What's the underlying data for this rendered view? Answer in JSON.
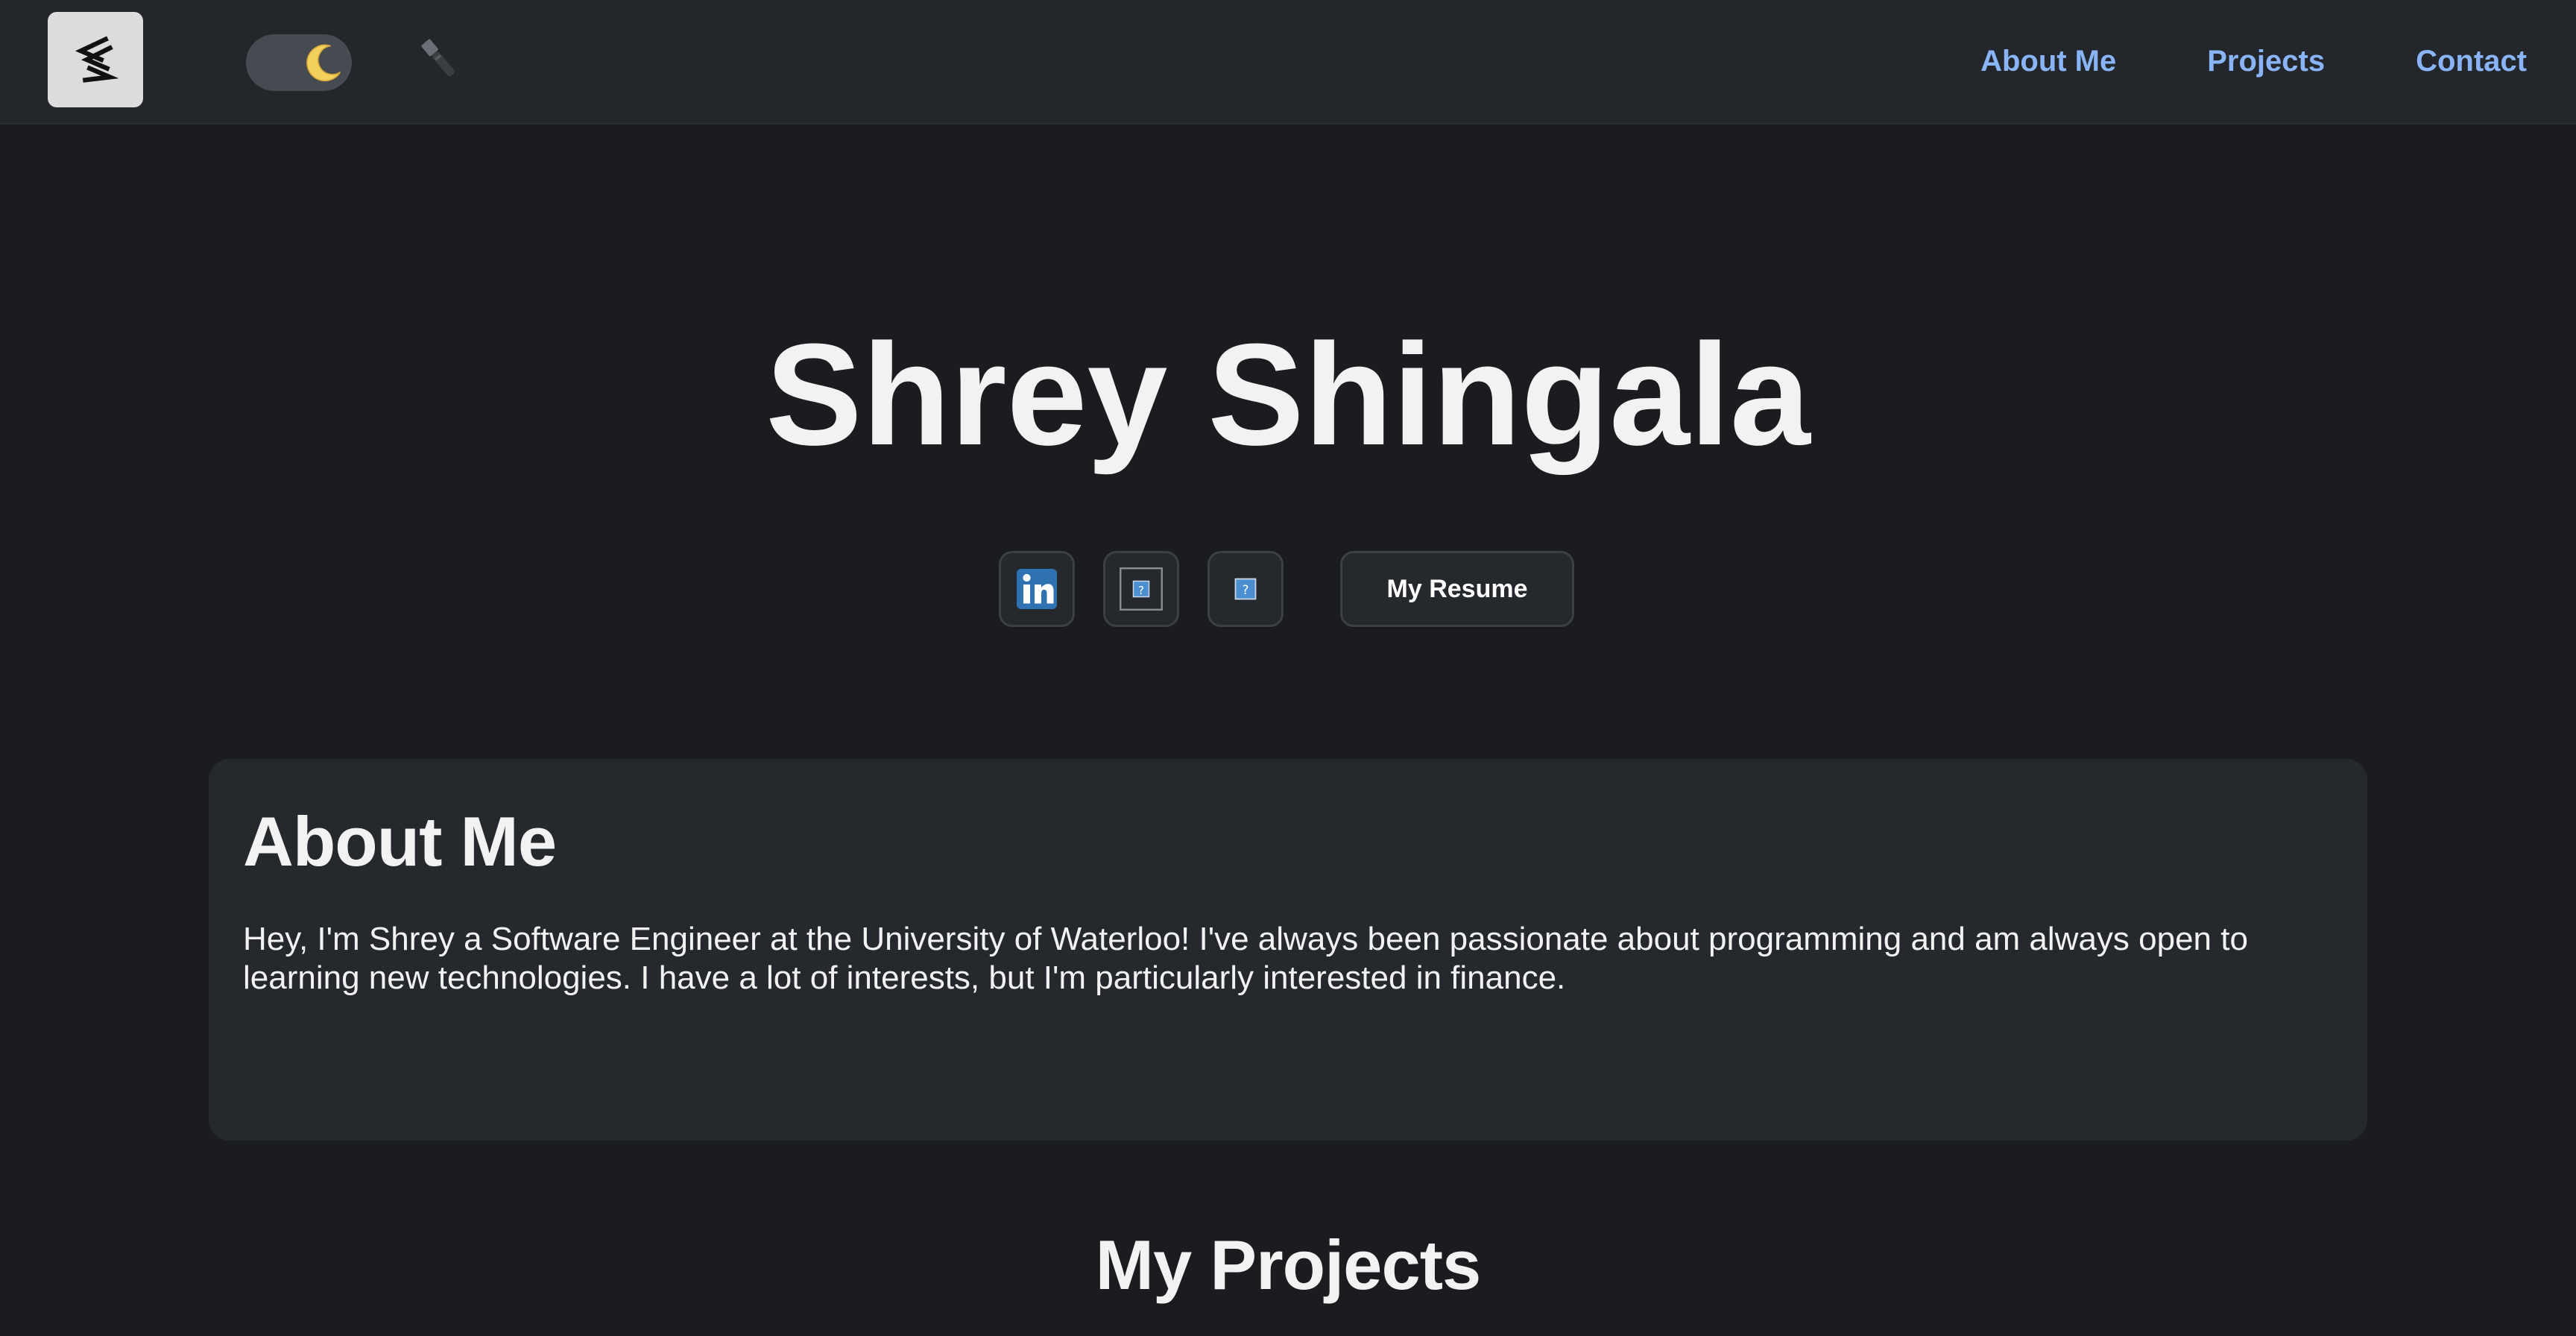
{
  "nav": {
    "logo_icon": "stylized-s-logo-icon",
    "theme_toggle_icon": "moon-icon",
    "flashlight_icon": "flashlight-icon",
    "links": [
      {
        "label": "About Me"
      },
      {
        "label": "Projects"
      },
      {
        "label": "Contact"
      }
    ],
    "link_color": "#8ab4f8"
  },
  "hero": {
    "name": "Shrey Shingala",
    "socials": [
      {
        "icon": "linkedin-icon"
      },
      {
        "icon": "broken-image-icon"
      },
      {
        "icon": "broken-image-icon"
      }
    ],
    "resume_label": "My Resume"
  },
  "about": {
    "title": "About Me",
    "text": "Hey, I'm Shrey a Software Engineer at the University of Waterloo! I've always been passionate about programming and am always open to learning new technologies. I have a lot of interests, but I'm particularly interested in finance."
  },
  "projects": {
    "title": "My Projects"
  },
  "colors": {
    "background": "#1b1c1f",
    "navbar": "#23262a",
    "card": "#25282c",
    "text": "#f2f2f2",
    "accent": "#8ab4f8"
  }
}
